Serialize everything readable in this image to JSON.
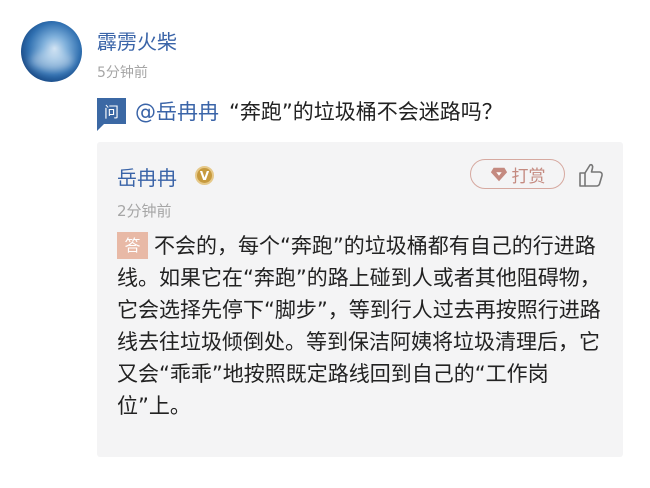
{
  "post": {
    "username": "霹雳火柴",
    "time": "5分钟前"
  },
  "question": {
    "badge": "问",
    "mention": "@岳冉冉",
    "text": "“奔跑”的垃圾桶不会迷路吗？"
  },
  "answer": {
    "author": "岳冉冉",
    "verified_badge": "V",
    "reward_label": "打赏",
    "time": "2分钟前",
    "badge": "答",
    "text": "不会的，每个“奔跑”的垃圾桶都有自己的行进路线。如果它在“奔跑”的路上碰到人或者其他阻碍物，它会选择先停下“脚步”，等到行人过去再按照行进路线去往垃圾倾倒处。等到保洁阿姨将垃圾清理后，它又会“乖乖”地按照既定路线回到自己的“工作岗位”上。"
  },
  "colors": {
    "link_blue": "#3a64a8",
    "question_badge": "#3b68a4",
    "answer_badge": "#e8b9a6",
    "reward_border": "#d6a9a0",
    "card_bg": "#f4f4f5"
  },
  "icons": {
    "reward": "diamond-icon",
    "like": "thumbs-up-icon",
    "verified": "verified-v-icon"
  }
}
